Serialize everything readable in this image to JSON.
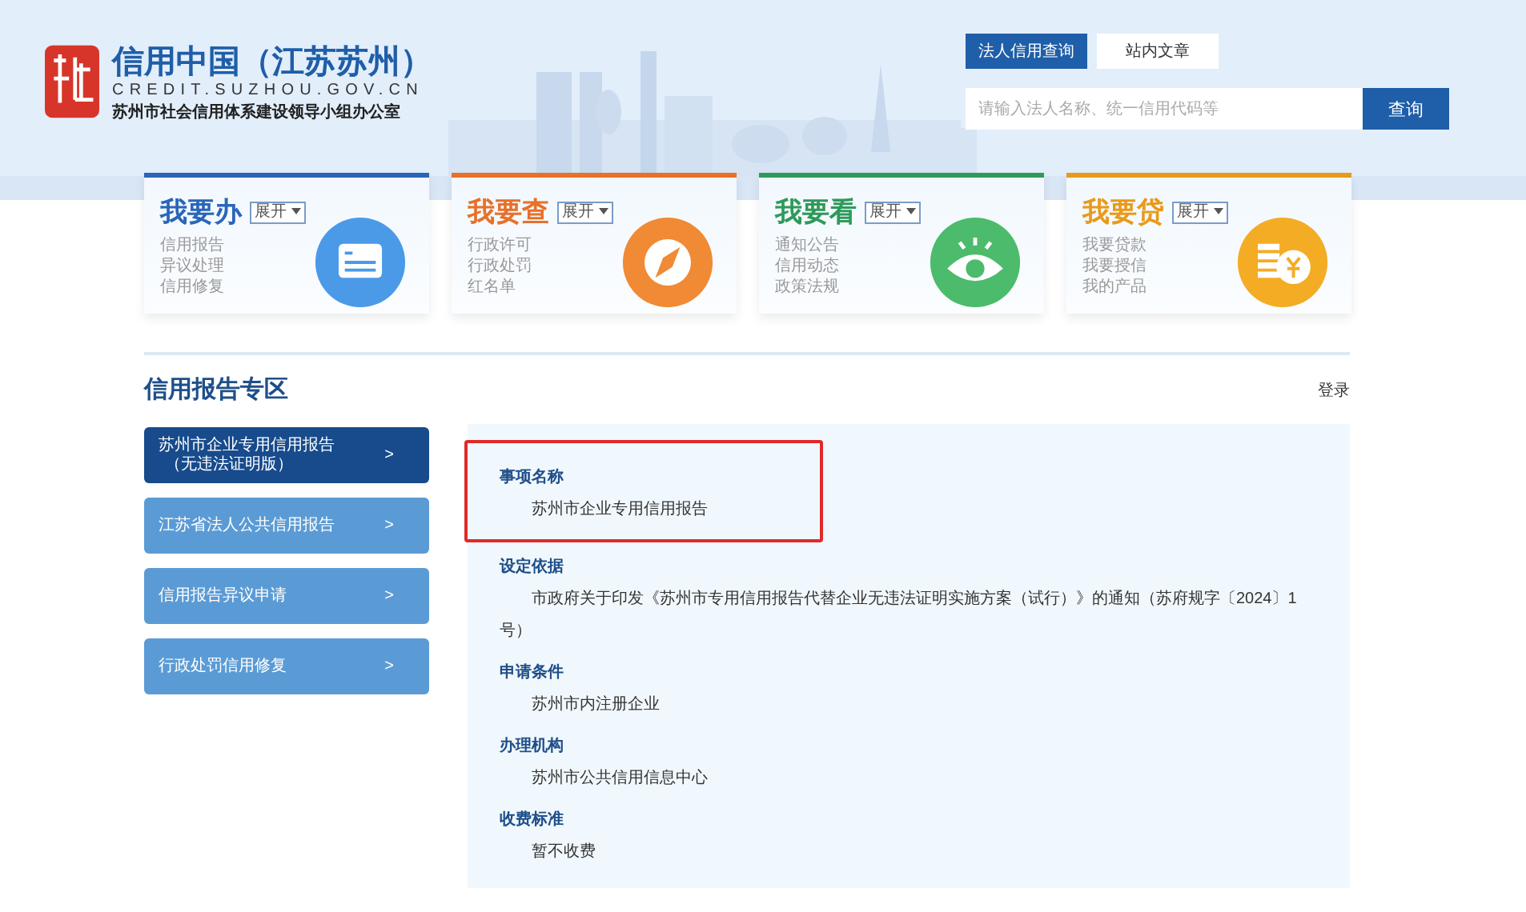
{
  "header": {
    "site_title": "信用中国（江苏苏州）",
    "site_url": "CREDIT.SUZHOU.GOV.CN",
    "organization": "苏州市社会信用体系建设领导小组办公室"
  },
  "search": {
    "tabs": [
      {
        "label": "法人信用查询",
        "selected": true
      },
      {
        "label": "站内文章",
        "selected": false
      }
    ],
    "placeholder": "请输入法人名称、统一信用代码等",
    "button": "查询"
  },
  "cards": [
    {
      "title": "我要办",
      "expand": "展开",
      "color": "#2a66b8",
      "kind": "form",
      "links": [
        "信用报告",
        "异议处理",
        "信用修复"
      ]
    },
    {
      "title": "我要查",
      "expand": "展开",
      "color": "#e8702a",
      "kind": "compass",
      "links": [
        "行政许可",
        "行政处罚",
        "红名单"
      ]
    },
    {
      "title": "我要看",
      "expand": "展开",
      "color": "#2e9a5a",
      "kind": "eye",
      "links": [
        "通知公告",
        "信用动态",
        "政策法规"
      ]
    },
    {
      "title": "我要贷",
      "expand": "展开",
      "color": "#e89a1a",
      "kind": "coins",
      "links": [
        "我要贷款",
        "我要授信",
        "我的产品"
      ]
    }
  ],
  "section": {
    "title": "信用报告专区",
    "login": "登录"
  },
  "sidebar": {
    "items": [
      {
        "lines": [
          "苏州市企业专用信用报告",
          "（无违法证明版）"
        ],
        "chevron": ">",
        "selected": true
      },
      {
        "lines": [
          "江苏省法人公共信用报告"
        ],
        "chevron": ">",
        "selected": false
      },
      {
        "lines": [
          "信用报告异议申请"
        ],
        "chevron": ">",
        "selected": false
      },
      {
        "lines": [
          "行政处罚信用修复"
        ],
        "chevron": ">",
        "selected": false
      }
    ]
  },
  "details": [
    {
      "heading": "事项名称",
      "text": "苏州市企业专用信用报告",
      "highlighted": true
    },
    {
      "heading": "设定依据",
      "text": "市政府关于印发《苏州市专用信用报告代替企业无违法证明实施方案（试行）》的通知（苏府规字〔2024〕1号）",
      "highlighted": false
    },
    {
      "heading": "申请条件",
      "text": "苏州市内注册企业",
      "highlighted": false
    },
    {
      "heading": "办理机构",
      "text": "苏州市公共信用信息中心",
      "highlighted": false
    },
    {
      "heading": "收费标准",
      "text": "暂不收费",
      "highlighted": false
    }
  ]
}
